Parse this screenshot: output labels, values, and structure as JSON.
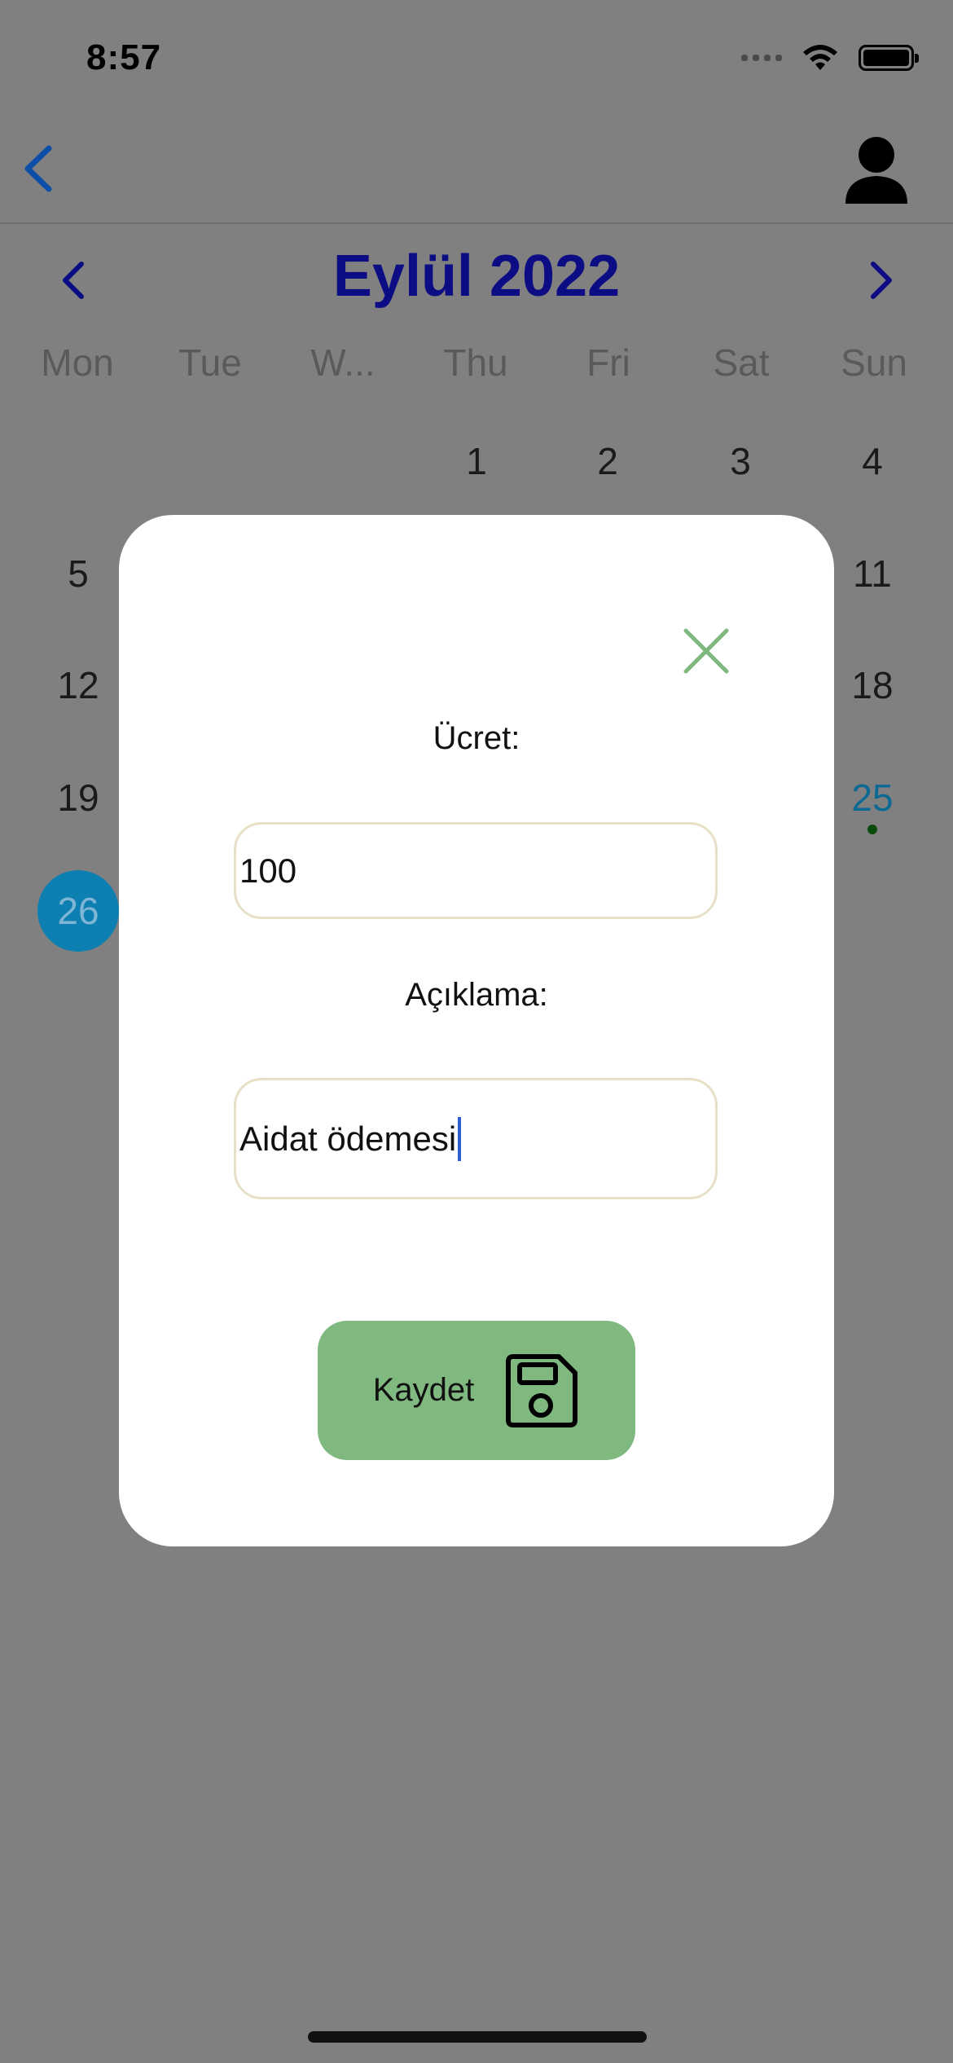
{
  "status_bar": {
    "time": "8:57"
  },
  "calendar": {
    "month_title": "Eylül 2022",
    "weekdays": [
      "Mon",
      "Tue",
      "W...",
      "Thu",
      "Fri",
      "Sat",
      "Sun"
    ],
    "visible_days": {
      "row1": [
        "1",
        "2",
        "3",
        "4"
      ],
      "row2": [
        "5",
        "11"
      ],
      "row3": [
        "12",
        "18"
      ],
      "row4": [
        "19",
        "25"
      ],
      "row5": [
        "26"
      ]
    },
    "highlighted_day": "25",
    "selected_day": "26"
  },
  "modal": {
    "price_label": "Ücret:",
    "price_value": "100",
    "description_label": "Açıklama:",
    "description_value": "Aidat ödemesi",
    "save_label": "Kaydet"
  },
  "colors": {
    "overlay": "#808080",
    "accent_blue": "#0c0c85",
    "save_green": "#80b980",
    "close_green": "#7fb87f",
    "selected_day": "#0d7fb0"
  },
  "icons": [
    "back-chevron-icon",
    "profile-icon",
    "chevron-left-icon",
    "chevron-right-icon",
    "close-icon",
    "floppy-disk-icon",
    "wifi-icon",
    "battery-icon",
    "signal-icon"
  ]
}
